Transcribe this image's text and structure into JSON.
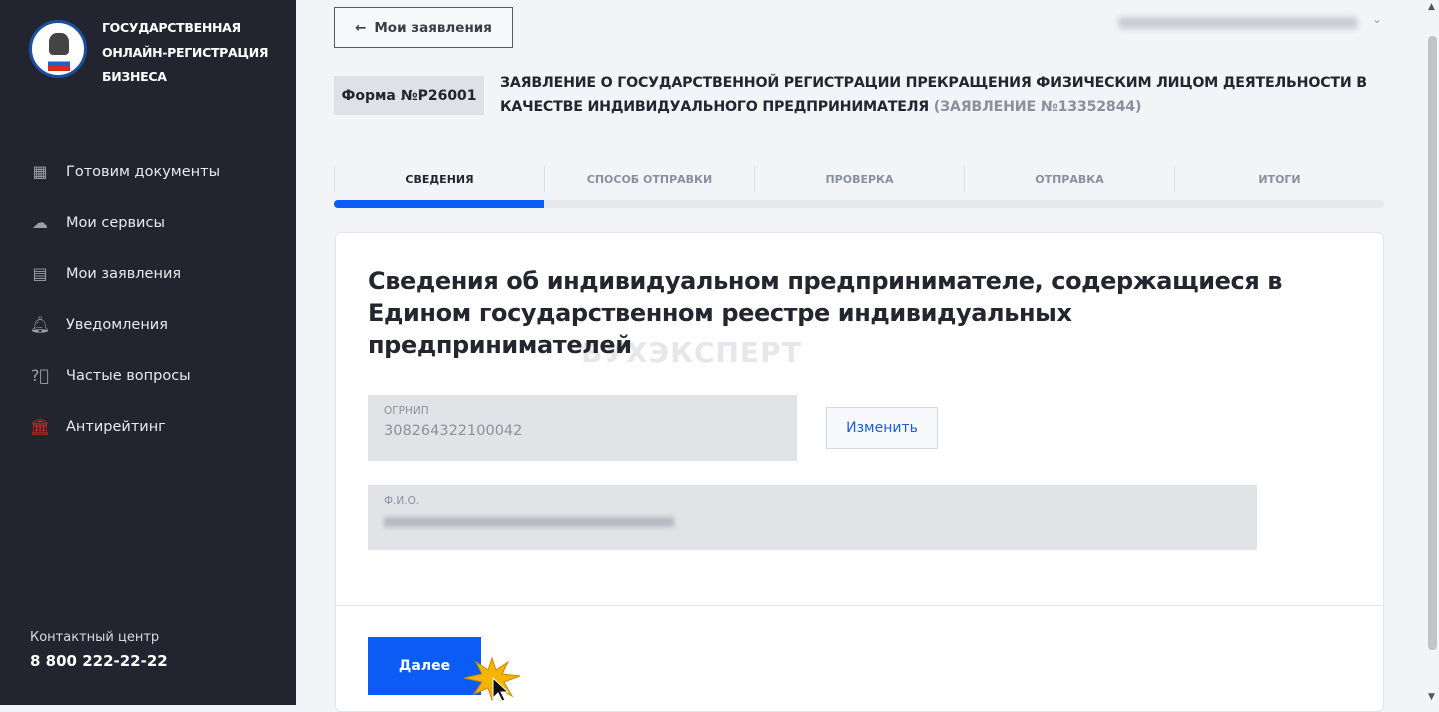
{
  "sidebar": {
    "brand": [
      "ГОСУДАРСТВЕННАЯ",
      "ОНЛАЙН-РЕГИСТРАЦИЯ",
      "БИЗНЕСА"
    ],
    "items": [
      {
        "label": "Готовим документы"
      },
      {
        "label": "Мои сервисы"
      },
      {
        "label": "Мои заявления"
      },
      {
        "label": "Уведомления"
      },
      {
        "label": "Частые вопросы"
      },
      {
        "label": "Антирейтинг"
      }
    ],
    "contact_label": "Контактный центр",
    "phone": "8 800 222-22-22"
  },
  "header": {
    "back_label": "Мои заявления",
    "form_tag": "Форма №Р26001",
    "title": "ЗАЯВЛЕНИЕ О ГОСУДАРСТВЕННОЙ РЕГИСТРАЦИИ ПРЕКРАЩЕНИЯ ФИЗИЧЕСКИМ ЛИЦОМ ДЕЯТЕЛЬНОСТИ В КАЧЕСТВЕ ИНДИВИДУАЛЬНОГО ПРЕДПРИНИМАТЕЛЯ",
    "app_number": "(ЗАЯВЛЕНИЕ №13352844)"
  },
  "steps": [
    {
      "label": "СВЕДЕНИЯ"
    },
    {
      "label": "СПОСОБ ОТПРАВКИ"
    },
    {
      "label": "ПРОВЕРКА"
    },
    {
      "label": "ОТПРАВКА"
    },
    {
      "label": "ИТОГИ"
    }
  ],
  "progress_percent": 20,
  "card": {
    "title": "Сведения об индивидуальном предпринимателе, содержащиеся в Едином государственном реестре индивидуальных предпринимателей",
    "watermark": "БУХЭКСПЕРТ",
    "ogrnip_label": "ОГРНИП",
    "ogrnip_value": "308264322100042",
    "change_label": "Изменить",
    "fio_label": "Ф.И.О.",
    "next_label": "Далее"
  },
  "colors": {
    "accent": "#0a5cf5",
    "sidebar": "#22252f",
    "antirating": "#d52b1e"
  }
}
